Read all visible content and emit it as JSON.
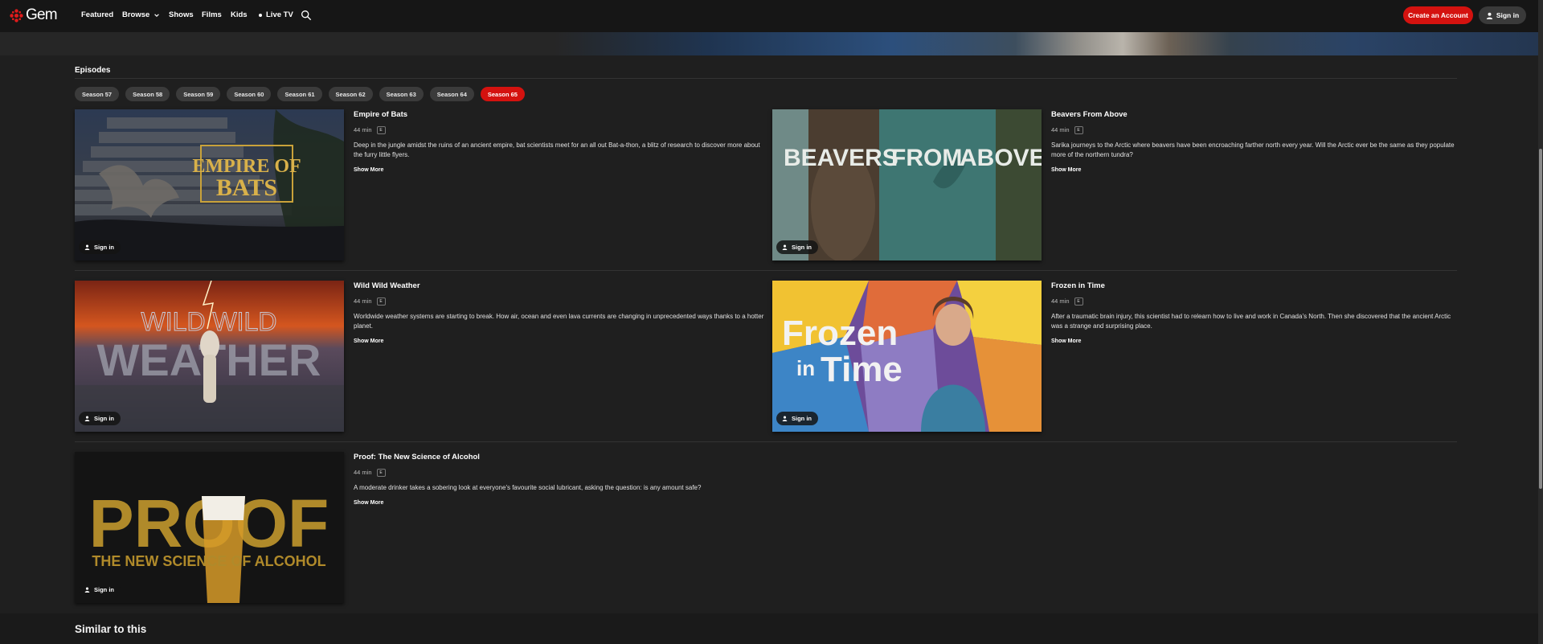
{
  "nav": {
    "logo": "Gem",
    "items": [
      "Featured",
      "Browse",
      "Shows",
      "Films",
      "Kids",
      "Live TV"
    ],
    "create_account": "Create an Account",
    "sign_in": "Sign in"
  },
  "episodes": {
    "heading": "Episodes",
    "seasons": [
      "Season 57",
      "Season 58",
      "Season 59",
      "Season 60",
      "Season 61",
      "Season 62",
      "Season 63",
      "Season 64",
      "Season 65"
    ],
    "selected_season": "Season 65",
    "list": [
      {
        "title": "Empire of Bats",
        "duration": "44 min",
        "rating": "E",
        "description": "Deep in the jungle amidst the ruins of an ancient empire, bat scientists meet for an all out Bat-a-thon, a blitz of research to discover more about the furry little flyers.",
        "show_more": "Show More",
        "sign_in": "Sign in",
        "art_text": [
          "EMPIRE OF",
          "BATS"
        ]
      },
      {
        "title": "Beavers From Above",
        "duration": "44 min",
        "rating": "E",
        "description": "Sarika journeys to the Arctic where beavers have been encroaching farther north every year. Will the Arctic ever be the same as they populate more of the northern tundra?",
        "show_more": "Show More",
        "sign_in": "Sign in",
        "art_text": [
          "BEAVERS",
          "FROM",
          "ABOVE"
        ]
      },
      {
        "title": "Wild Wild Weather",
        "duration": "44 min",
        "rating": "E",
        "description": "Worldwide weather systems are starting to break. How air, ocean and even lava currents are changing in unprecedented ways thanks to a hotter planet.",
        "show_more": "Show More",
        "sign_in": "Sign in",
        "art_text": [
          "WILD WILD",
          "WEATHER"
        ]
      },
      {
        "title": "Frozen in Time",
        "duration": "44 min",
        "rating": "E",
        "description": "After a traumatic brain injury, this scientist had to relearn how to live and work in Canada’s North. Then she discovered that the ancient Arctic was a strange and surprising place.",
        "show_more": "Show More",
        "sign_in": "Sign in",
        "art_text": [
          "Frozen",
          "in",
          "Time"
        ]
      },
      {
        "title": "Proof: The New Science of Alcohol",
        "duration": "44 min",
        "rating": "E",
        "description": "A moderate drinker takes a sobering look at everyone's favourite social lubricant, asking the question: is any amount safe?",
        "show_more": "Show More",
        "sign_in": "Sign in",
        "art_text": [
          "PROOF",
          "THE NEW SCIENCE OF ALCOHOL"
        ]
      }
    ]
  },
  "similar": {
    "heading": "Similar to this"
  },
  "colors": {
    "accent": "#d4120f",
    "background": "#1f1f1f",
    "nav_background": "#161616",
    "pill": "#3b3b3b"
  }
}
